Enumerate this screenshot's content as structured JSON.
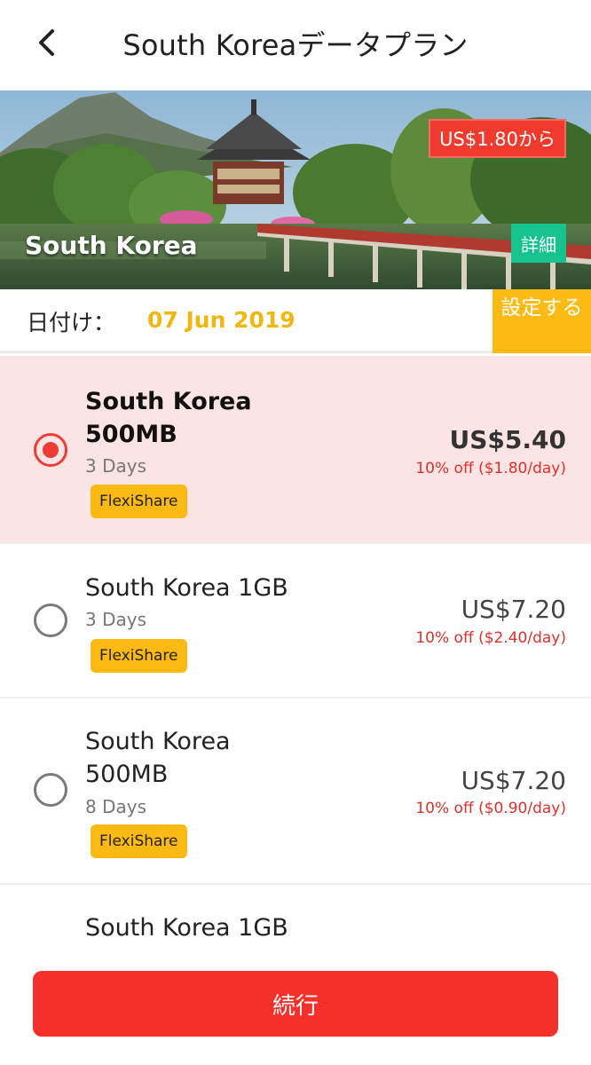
{
  "header": {
    "title": "South Koreaデータプラン",
    "back_icon": "chevron-left-icon"
  },
  "hero": {
    "price_from": "US$1.80から",
    "country": "South Korea",
    "details_label": "詳細"
  },
  "date": {
    "label": "日付け：",
    "value": "07 Jun 2019",
    "set_label": "設定する"
  },
  "plans": [
    {
      "name": "South Korea 500MB",
      "days": "3 Days",
      "badge": "FlexiShare",
      "price": "US$5.40",
      "discount": "10% off ($1.80/day)",
      "selected": true
    },
    {
      "name": "South Korea 1GB",
      "days": "3 Days",
      "badge": "FlexiShare",
      "price": "US$7.20",
      "discount": "10% off ($2.40/day)",
      "selected": false
    },
    {
      "name": "South Korea 500MB",
      "days": "8 Days",
      "badge": "FlexiShare",
      "price": "US$7.20",
      "discount": "10% off ($0.90/day)",
      "selected": false
    },
    {
      "name": "South Korea 1GB"
    }
  ],
  "footer": {
    "continue_label": "続行"
  },
  "colors": {
    "primary_red": "#f5302a",
    "accent_yellow": "#fbba14",
    "details_green": "#16c38e",
    "selected_bg": "#fde4e4"
  }
}
